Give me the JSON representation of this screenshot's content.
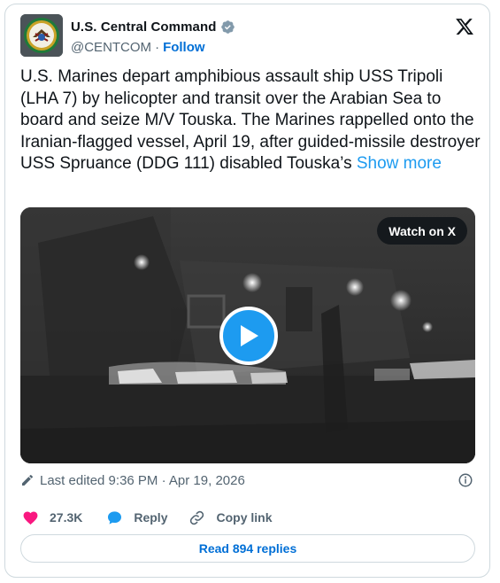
{
  "author": {
    "name": "U.S. Central Command",
    "handle": "@CENTCOM",
    "separator": "·",
    "follow_label": "Follow"
  },
  "icons": {
    "verified": "verified-badge-icon",
    "x_logo": "x-logo-icon",
    "pencil": "pencil-icon",
    "info": "info-icon",
    "heart": "heart-icon",
    "reply": "reply-bubble-icon",
    "link": "link-icon",
    "play": "play-icon"
  },
  "tweet": {
    "text": "U.S. Marines depart amphibious assault ship USS Tripoli (LHA 7) by helicopter and transit over the Arabian Sea to board and seize M/V Touska. The Marines rappelled onto the Iranian-flagged vessel, April 19, after guided-missile destroyer USS Spruance (DDG 111) disabled Touska’s",
    "show_more": "Show more"
  },
  "media": {
    "watch_label": "Watch on X"
  },
  "meta": {
    "edited": "Last edited 9:36 PM · Apr 19, 2026"
  },
  "actions": {
    "likes": "27.3K",
    "reply_label": "Reply",
    "copy_link_label": "Copy link"
  },
  "replies_button": "Read 894 replies",
  "colors": {
    "accent": "#1d9bf0",
    "link_blue": "#006fd6",
    "like_pink": "#f91880",
    "muted": "#536471",
    "border": "#cfd9de"
  }
}
